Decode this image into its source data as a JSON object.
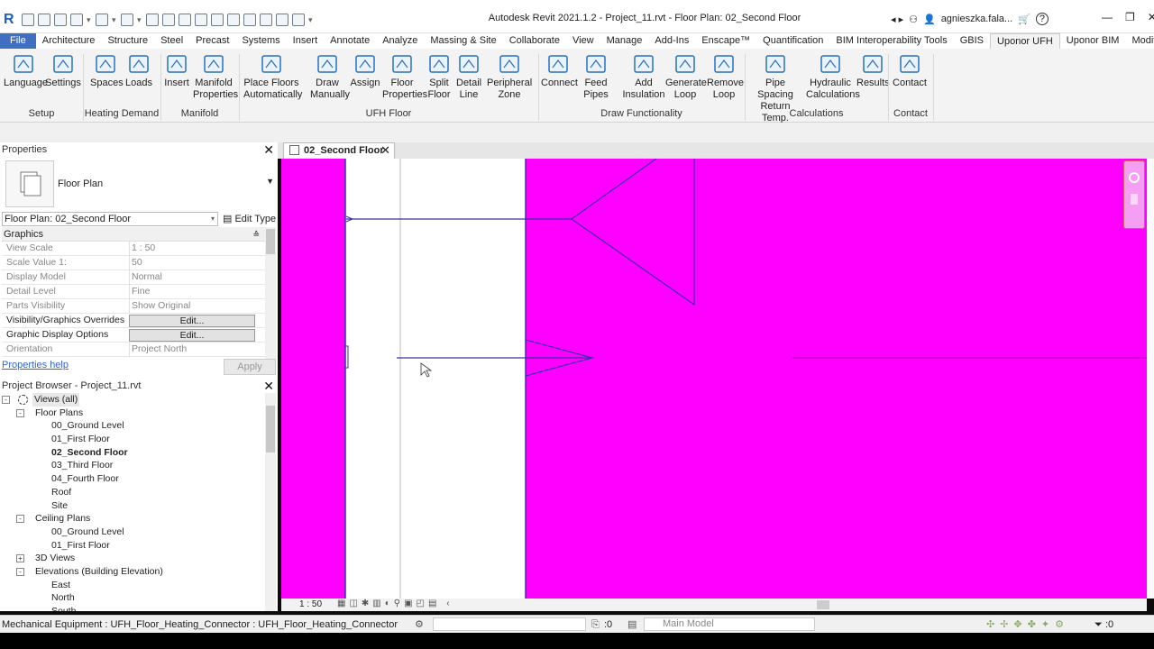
{
  "window": {
    "title": "Autodesk Revit 2021.1.2 - Project_11.rvt - Floor Plan: 02_Second Floor",
    "user": "agnieszka.fala...",
    "logo": "R"
  },
  "tabs": [
    "File",
    "Architecture",
    "Structure",
    "Steel",
    "Precast",
    "Systems",
    "Insert",
    "Annotate",
    "Analyze",
    "Massing & Site",
    "Collaborate",
    "View",
    "Manage",
    "Add-Ins",
    "Enscape™",
    "Quantification",
    "BIM Interoperability Tools",
    "GBIS",
    "Uponor UFH",
    "Uponor BIM",
    "Modify"
  ],
  "ribbon": {
    "panels": [
      {
        "name": "Setup",
        "tools": [
          {
            "line1": "Language",
            "line2": ""
          },
          {
            "line1": "Settings",
            "line2": ""
          }
        ]
      },
      {
        "name": "Heating Demand",
        "tools": [
          {
            "line1": "Spaces",
            "line2": ""
          },
          {
            "line1": "Loads",
            "line2": ""
          }
        ]
      },
      {
        "name": "Manifold",
        "tools": [
          {
            "line1": "Insert",
            "line2": ""
          },
          {
            "line1": "Manifold",
            "line2": "Properties"
          }
        ]
      },
      {
        "name": "UFH Floor",
        "tools": [
          {
            "line1": "Place Floors",
            "line2": "Automatically"
          },
          {
            "line1": "Draw",
            "line2": "Manually"
          },
          {
            "line1": "Assign",
            "line2": ""
          },
          {
            "line1": "Floor",
            "line2": "Properties"
          },
          {
            "line1": "Split",
            "line2": "Floor"
          },
          {
            "line1": "Detail",
            "line2": "Line"
          },
          {
            "line1": "Peripheral",
            "line2": "Zone"
          }
        ]
      },
      {
        "name": "Draw Functionality",
        "tools": [
          {
            "line1": "Connect",
            "line2": ""
          },
          {
            "line1": "Feed",
            "line2": "Pipes"
          },
          {
            "line1": "Add",
            "line2": "Insulation"
          },
          {
            "line1": "Generate",
            "line2": "Loop"
          },
          {
            "line1": "Remove",
            "line2": "Loop"
          }
        ]
      },
      {
        "name": "Calculations",
        "tools": [
          {
            "line1": "Pipe Spacing",
            "line2": "Return Temp."
          },
          {
            "line1": "Hydraulic",
            "line2": "Calculations"
          },
          {
            "line1": "Results",
            "line2": ""
          }
        ]
      },
      {
        "name": "Contact",
        "tools": [
          {
            "line1": "Contact",
            "line2": ""
          }
        ]
      }
    ]
  },
  "properties": {
    "header": "Properties",
    "type_name": "Floor Plan",
    "instance_selector": "Floor Plan: 02_Second Floor",
    "edit_type": "Edit Type",
    "group": "Graphics",
    "rows": [
      {
        "name": "View Scale",
        "value": "1 : 50"
      },
      {
        "name": "Scale Value    1:",
        "value": "50"
      },
      {
        "name": "Display Model",
        "value": "Normal"
      },
      {
        "name": "Detail Level",
        "value": "Fine"
      },
      {
        "name": "Parts Visibility",
        "value": "Show Original"
      },
      {
        "name": "Visibility/Graphics Overrides",
        "value": "Edit..."
      },
      {
        "name": "Graphic Display Options",
        "value": "Edit..."
      },
      {
        "name": "Orientation",
        "value": "Project North"
      }
    ],
    "help": "Properties help",
    "apply": "Apply"
  },
  "browser": {
    "header": "Project Browser - Project_11.rvt",
    "nodes": [
      {
        "label": "Views (all)",
        "level": 0,
        "exp": "-"
      },
      {
        "label": "Floor Plans",
        "level": 1,
        "exp": "-"
      },
      {
        "label": "00_Ground Level",
        "level": 2
      },
      {
        "label": "01_First Floor",
        "level": 2
      },
      {
        "label": "02_Second Floor",
        "level": 2,
        "bold": true
      },
      {
        "label": "03_Third Floor",
        "level": 2
      },
      {
        "label": "04_Fourth Floor",
        "level": 2
      },
      {
        "label": "Roof",
        "level": 2
      },
      {
        "label": "Site",
        "level": 2
      },
      {
        "label": "Ceiling Plans",
        "level": 1,
        "exp": "-"
      },
      {
        "label": "00_Ground Level",
        "level": 2
      },
      {
        "label": "01_First Floor",
        "level": 2
      },
      {
        "label": "3D Views",
        "level": 1,
        "exp": "+"
      },
      {
        "label": "Elevations (Building Elevation)",
        "level": 1,
        "exp": "-"
      },
      {
        "label": "East",
        "level": 2
      },
      {
        "label": "North",
        "level": 2
      },
      {
        "label": "South",
        "level": 2
      }
    ]
  },
  "view": {
    "tab": "02_Second Floor",
    "scale": "1 : 50",
    "fill_color": "#ff00ff",
    "line_color": "#3a2ea8"
  },
  "status": {
    "text": "Mechanical Equipment : UFH_Floor_Heating_Connector : UFH_Floor_Heating_Connector",
    "count": ":0",
    "model": "Main Model",
    "filter": ":0"
  },
  "colors": {
    "accent": "#3f6ec2",
    "ribbon_icon": "#2a6fb8"
  }
}
